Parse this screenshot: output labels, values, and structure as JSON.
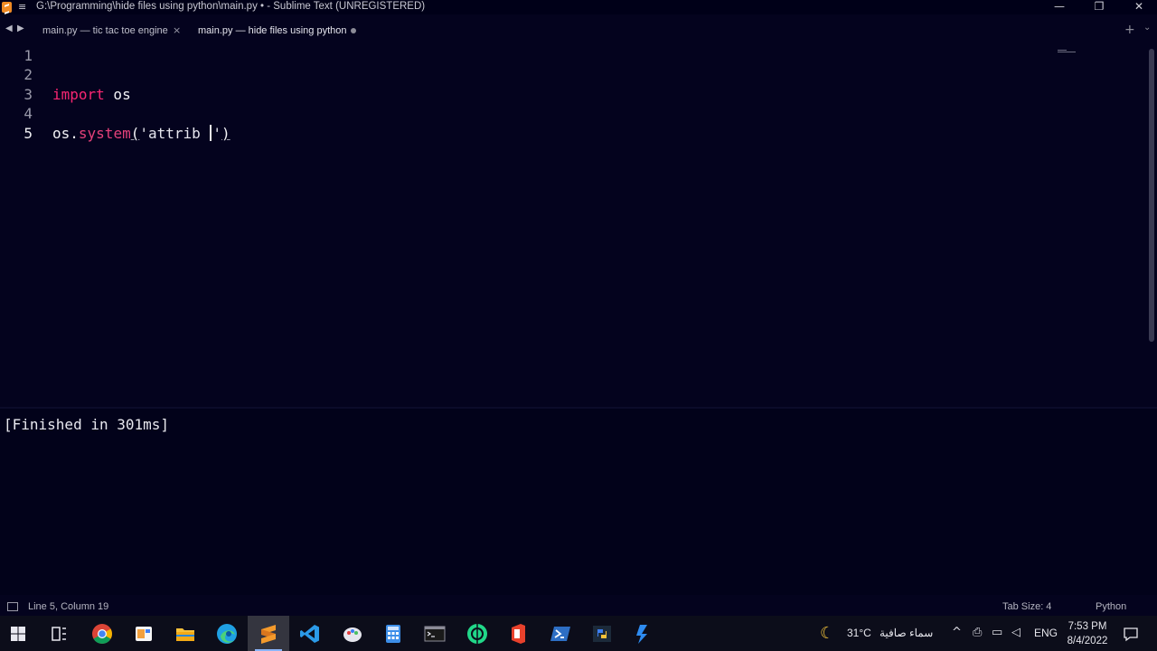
{
  "window": {
    "title": "G:\\Programming\\hide files using python\\main.py • - Sublime Text (UNREGISTERED)",
    "minimize": "—",
    "restore": "❐",
    "close": "✕"
  },
  "tabs": [
    {
      "label": "main.py — tic tac toe engine",
      "close": "×",
      "active": false
    },
    {
      "label": "main.py — hide files using python",
      "active": true,
      "dirty": true
    }
  ],
  "tab_nav": {
    "back": "◀",
    "forward": "▶",
    "new_tab": "+",
    "more": "⌄"
  },
  "editor": {
    "line_numbers": [
      "1",
      "2",
      "3",
      "4",
      "5"
    ],
    "active_line": "5",
    "line3": {
      "keyword": "import",
      "module": " os"
    },
    "line5": {
      "object": "os.",
      "function": "system",
      "open_paren": "(",
      "string_open": "'attrib ",
      "string_close": "'",
      "close_paren": ")"
    }
  },
  "output": {
    "text": "[Finished in 301ms]"
  },
  "status": {
    "position": "Line 5, Column 19",
    "tab_size": "Tab Size: 4",
    "syntax": "Python"
  },
  "taskbar": {
    "apps": [
      "windows-start",
      "task-view",
      "chrome",
      "files",
      "file-explorer",
      "edge",
      "sublime-text",
      "vs-code",
      "paint",
      "calculator",
      "terminal",
      "pycharm",
      "office",
      "powershell",
      "python-installer",
      "windsurf"
    ],
    "weather_temp": "31°C",
    "weather_desc": "سماء صافية",
    "language": "ENG",
    "time": "7:53 PM",
    "date": "8/4/2022"
  },
  "colors": {
    "editor_bg": "#04031e",
    "keyword": "#f92672",
    "sublime_orange": "#f08a24"
  }
}
